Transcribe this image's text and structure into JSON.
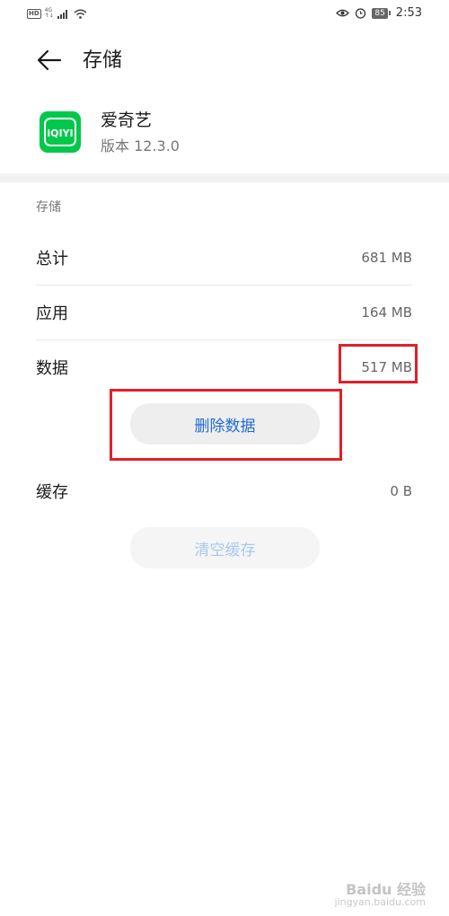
{
  "status_bar": {
    "left_badge": "HD",
    "network_top": "4G",
    "network_bottom": "↑↓",
    "battery": "85",
    "time": "2:53"
  },
  "header": {
    "title": "存储"
  },
  "app": {
    "icon_text": "iQIYI",
    "name": "爱奇艺",
    "version": "版本 12.3.0"
  },
  "storage": {
    "section_label": "存储",
    "rows": [
      {
        "label": "总计",
        "value": "681 MB"
      },
      {
        "label": "应用",
        "value": "164 MB"
      },
      {
        "label": "数据",
        "value": "517 MB"
      }
    ],
    "delete_button": "删除数据",
    "cache": {
      "label": "缓存",
      "value": "0 B"
    },
    "clear_cache_button": "清空缓存"
  },
  "watermark": {
    "main": "Baidu 经验",
    "sub": "jingyan.baidu.com"
  },
  "colors": {
    "accent": "#1d6bd6",
    "annotation": "#e0202a",
    "app_icon": "#00c84a"
  }
}
